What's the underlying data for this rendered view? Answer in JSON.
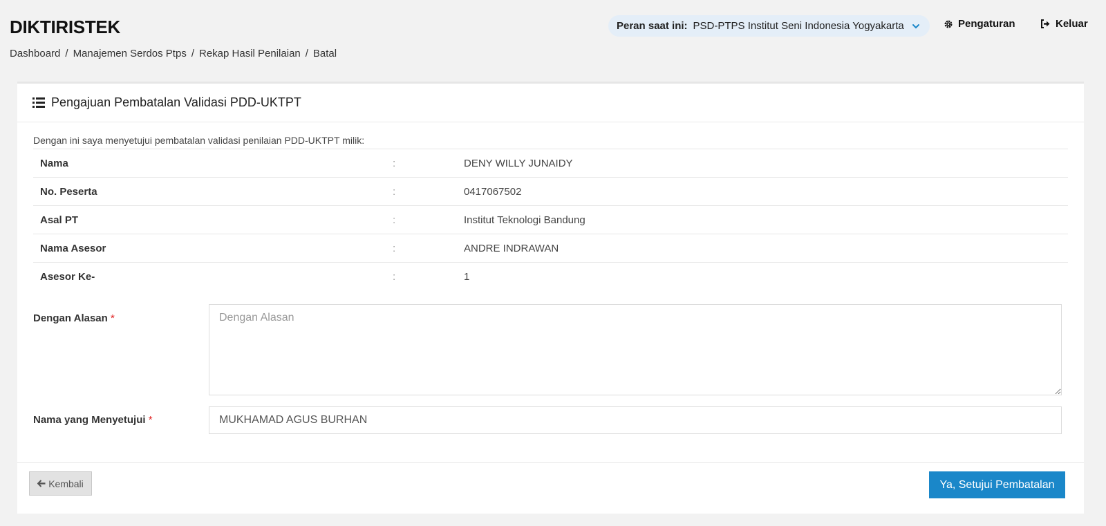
{
  "app": {
    "brand": "DIKTIRISTEK"
  },
  "breadcrumb": [
    "Dashboard",
    "Manajemen Serdos Ptps",
    "Rekap Hasil Penilaian",
    "Batal"
  ],
  "role": {
    "label": "Peran saat ini:",
    "value": "PSD-PTPS Institut Seni Indonesia Yogyakarta"
  },
  "nav": {
    "settings": "Pengaturan",
    "logout": "Keluar"
  },
  "card": {
    "title": "Pengajuan Pembatalan Validasi PDD-UKTPT",
    "intro": "Dengan ini saya menyetujui pembatalan validasi penilaian PDD-UKTPT milik:",
    "details": [
      {
        "label": "Nama",
        "sep": ":",
        "value": "DENY WILLY JUNAIDY"
      },
      {
        "label": "No. Peserta",
        "sep": ":",
        "value": "0417067502"
      },
      {
        "label": "Asal PT",
        "sep": ":",
        "value": "Institut Teknologi Bandung"
      },
      {
        "label": "Nama Asesor",
        "sep": ":",
        "value": "ANDRE INDRAWAN"
      },
      {
        "label": "Asesor Ke-",
        "sep": ":",
        "value": "1"
      }
    ]
  },
  "form": {
    "required_mark": "*",
    "reason": {
      "label": "Dengan Alasan",
      "placeholder": "Dengan Alasan",
      "value": ""
    },
    "approver": {
      "label": "Nama yang Menyetujui",
      "value": "MUKHAMAD AGUS BURHAN"
    }
  },
  "footer": {
    "back_label": "Kembali",
    "approve_label": "Ya, Setujui Pembatalan"
  },
  "colors": {
    "primary": "#1a87c9",
    "required": "#e02020",
    "role_bg": "#e4eef8"
  }
}
